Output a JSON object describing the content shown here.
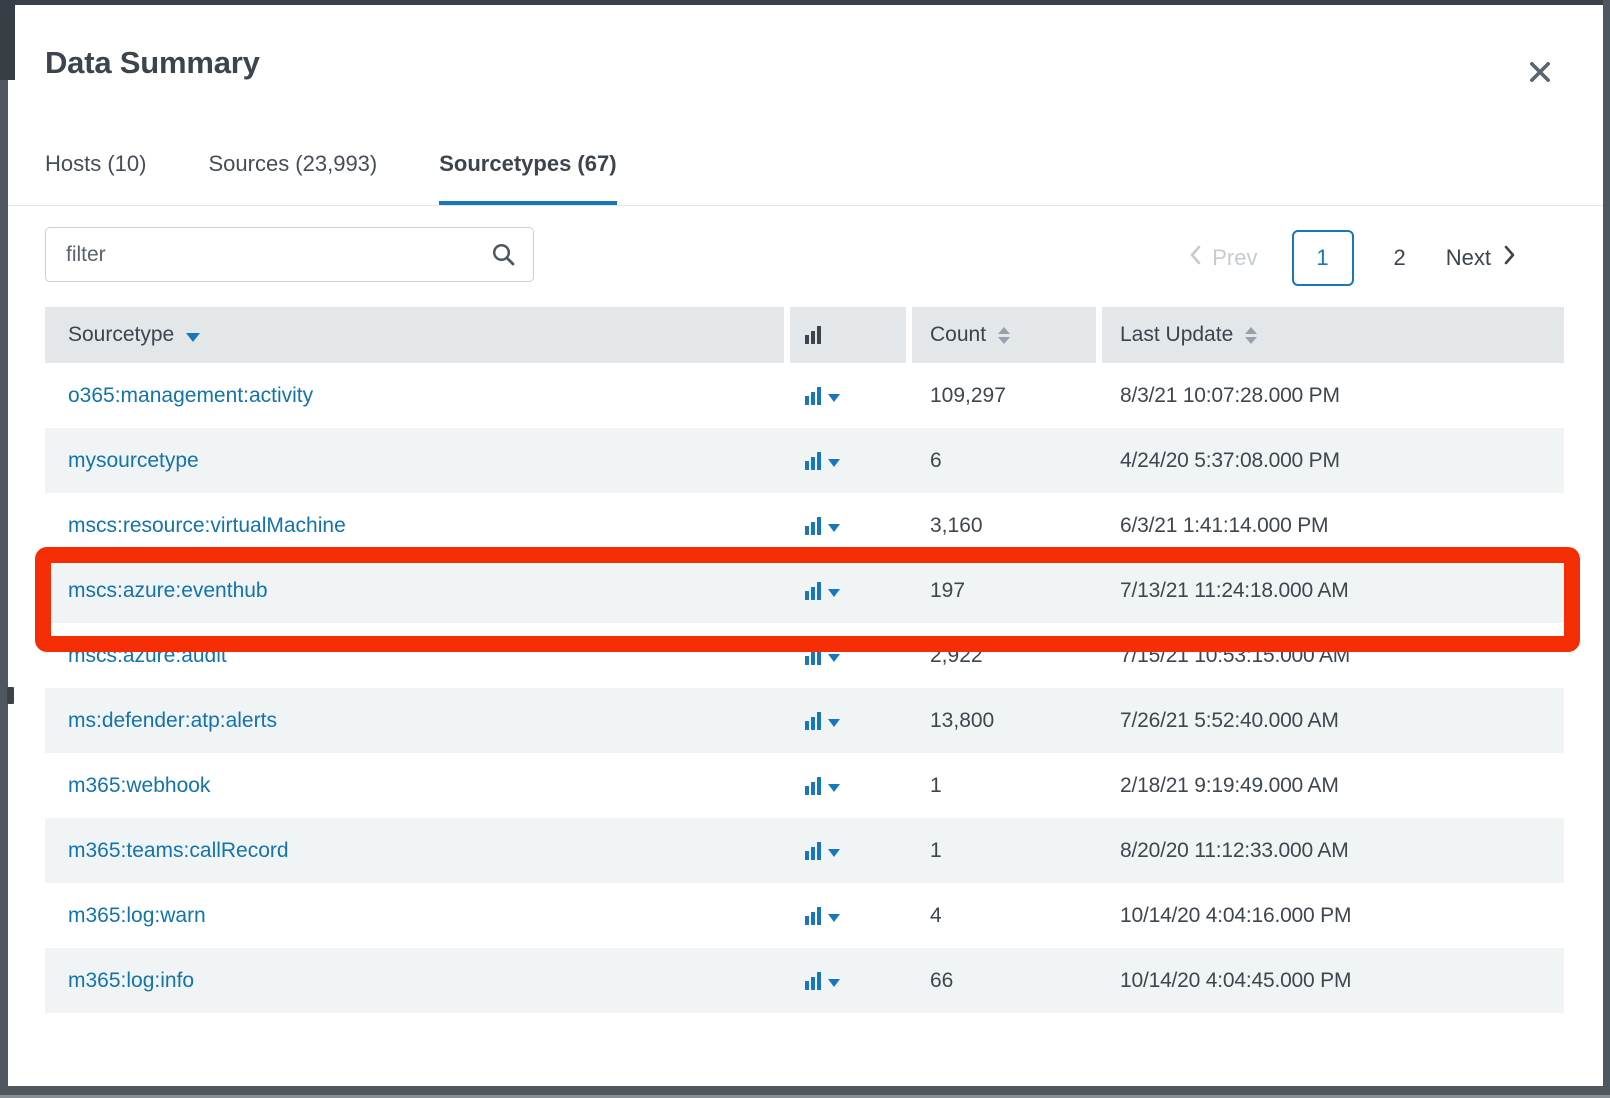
{
  "window": {
    "title": "Data Summary"
  },
  "tabs": {
    "items": [
      {
        "label": "Hosts (10)"
      },
      {
        "label": "Sources (23,993)"
      },
      {
        "label": "Sourcetypes (67)"
      }
    ],
    "active_index": 2
  },
  "toolbar": {
    "filter_placeholder": "filter"
  },
  "pagination": {
    "prev_label": "Prev",
    "page_1": "1",
    "page_2": "2",
    "next_label": "Next",
    "current_page": "1"
  },
  "table": {
    "headers": {
      "sourcetype": "Sourcetype",
      "count": "Count",
      "last_update": "Last Update"
    },
    "sort": {
      "column": "Sourcetype",
      "direction": "descending"
    },
    "rows": [
      {
        "sourcetype": "o365:management:activity",
        "count": "109,297",
        "last_update": "8/3/21 10:07:28.000 PM"
      },
      {
        "sourcetype": "mysourcetype",
        "count": "6",
        "last_update": "4/24/20 5:37:08.000 PM"
      },
      {
        "sourcetype": "mscs:resource:virtualMachine",
        "count": "3,160",
        "last_update": "6/3/21 1:41:14.000 PM"
      },
      {
        "sourcetype": "mscs:azure:eventhub",
        "count": "197",
        "last_update": "7/13/21 11:24:18.000 AM"
      },
      {
        "sourcetype": "mscs:azure:audit",
        "count": "2,922",
        "last_update": "7/15/21 10:53:15.000 AM"
      },
      {
        "sourcetype": "ms:defender:atp:alerts",
        "count": "13,800",
        "last_update": "7/26/21 5:52:40.000 AM"
      },
      {
        "sourcetype": "m365:webhook",
        "count": "1",
        "last_update": "2/18/21 9:19:49.000 AM"
      },
      {
        "sourcetype": "m365:teams:callRecord",
        "count": "1",
        "last_update": "8/20/20 11:12:33.000 AM"
      },
      {
        "sourcetype": "m365:log:warn",
        "count": "4",
        "last_update": "10/14/20 4:04:16.000 PM"
      },
      {
        "sourcetype": "m365:log:info",
        "count": "66",
        "last_update": "10/14/20 4:04:45.000 PM"
      }
    ]
  },
  "annotation": {
    "type": "highlight-box",
    "color": "#f42d05",
    "highlighted_sourcetype": "mscs:azure:eventhub"
  },
  "colors": {
    "accent_blue": "#1876bd",
    "link_blue": "#1273ad",
    "annotation_red": "#f42d05",
    "table_header_bg": "#e3e7ea",
    "row_alt_bg": "#f1f4f5"
  }
}
